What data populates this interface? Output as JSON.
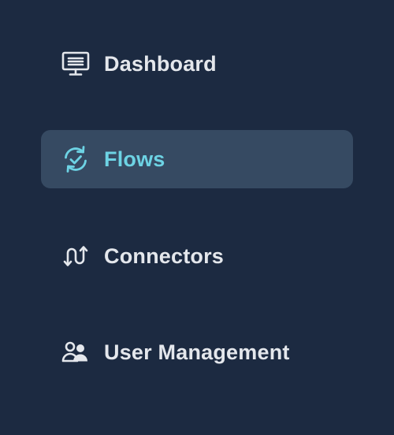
{
  "colors": {
    "background": "#1c2a41",
    "active_background": "#364a62",
    "text": "#e4e7ec",
    "accent": "#6dd3e4"
  },
  "nav": {
    "active": "flows",
    "items": [
      {
        "id": "dashboard",
        "label": "Dashboard",
        "icon": "dashboard-monitor-icon"
      },
      {
        "id": "flows",
        "label": "Flows",
        "icon": "flows-sync-check-icon"
      },
      {
        "id": "connectors",
        "label": "Connectors",
        "icon": "connectors-arrows-icon"
      },
      {
        "id": "users",
        "label": "User Management",
        "icon": "user-management-icon"
      }
    ]
  }
}
